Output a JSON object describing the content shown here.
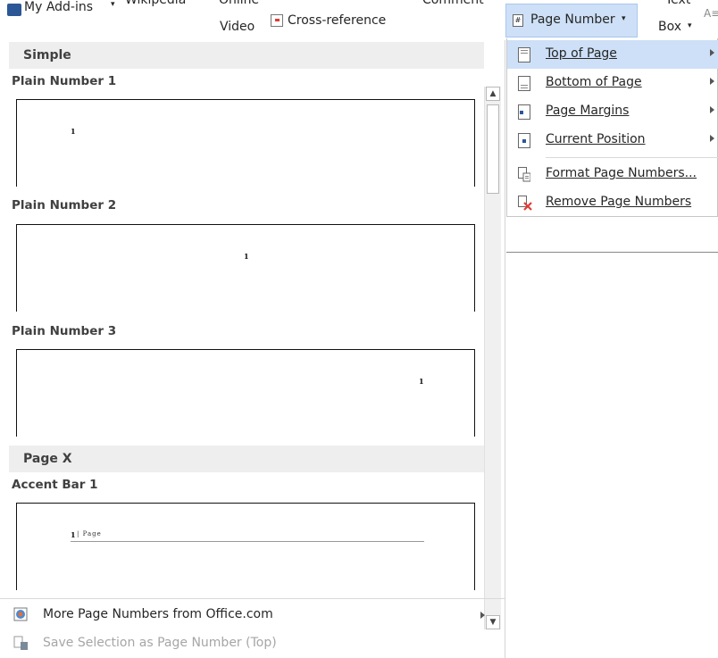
{
  "ribbon": {
    "my_addins": "My Add-ins",
    "wikipedia": "Wikipedia",
    "online": "Online",
    "video": "Video",
    "cross_reference": "Cross-reference",
    "comment": "Comment",
    "page_number": "Page Number",
    "text": "Text",
    "box": "Box"
  },
  "gallery": {
    "sections": [
      {
        "header": "Simple"
      },
      {
        "header": "Page X"
      }
    ],
    "items": [
      {
        "title": "Plain Number 1",
        "number": "1"
      },
      {
        "title": "Plain Number 2",
        "number": "1"
      },
      {
        "title": "Plain Number 3",
        "number": "1"
      },
      {
        "title": "Accent Bar 1",
        "number": "1",
        "suffix": "| Page"
      }
    ],
    "more_label": "More Page Numbers from Office.com",
    "save_label": "Save Selection as Page Number (Top)"
  },
  "menu": {
    "items": [
      {
        "label": "Top of Page",
        "has_submenu": true
      },
      {
        "label": "Bottom of Page",
        "has_submenu": true
      },
      {
        "label": "Page Margins",
        "has_submenu": true
      },
      {
        "label": "Current Position",
        "has_submenu": true
      },
      {
        "label": "Format Page Numbers...",
        "has_submenu": false
      },
      {
        "label": "Remove Page Numbers",
        "has_submenu": false
      }
    ]
  },
  "colors": {
    "hover": "#cde0f7",
    "section_bg": "#eeeeee",
    "remove_red": "#e03c31",
    "addin_blue": "#2b5797"
  }
}
